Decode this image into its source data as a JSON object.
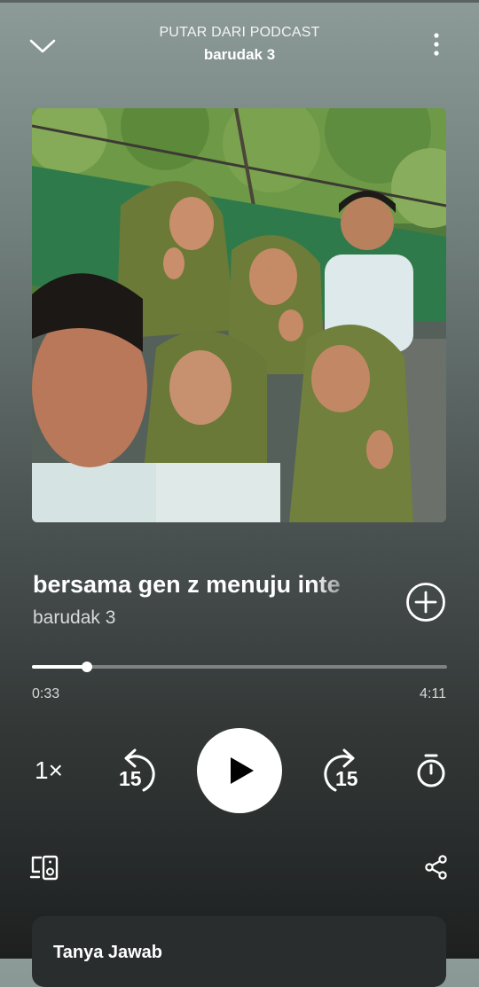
{
  "header": {
    "subtitle": "PUTAR DARI PODCAST",
    "title": "barudak 3"
  },
  "episode": {
    "title": "bersama gen z menuju inte",
    "show": "barudak 3"
  },
  "progress": {
    "elapsed": "0:33",
    "duration": "4:11",
    "fraction": 0.1315
  },
  "controls": {
    "speed": "1×",
    "skip_back_seconds": "15",
    "skip_forward_seconds": "15"
  },
  "icons": {
    "collapse": "chevron-down-icon",
    "more": "more-vertical-icon",
    "add": "add-circle-icon",
    "play": "play-icon",
    "sleep_timer": "timer-icon",
    "devices": "connect-device-icon",
    "share": "share-icon"
  },
  "card": {
    "title": "Tanya Jawab"
  },
  "colors": {
    "background_top": "#8c9b98",
    "background_bottom": "#1e2020",
    "accent": "#ffffff",
    "card": "#2a2d2d"
  }
}
